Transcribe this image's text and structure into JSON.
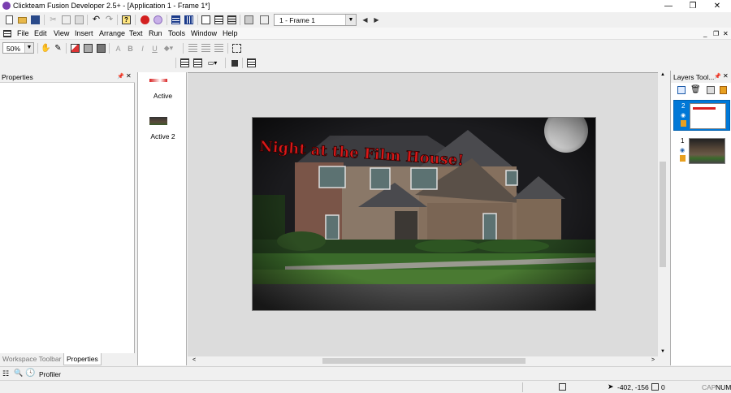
{
  "window": {
    "title": "Clickteam Fusion Developer 2.5+ - [Application 1 - Frame 1*]",
    "minimize_label": "—",
    "restore_label": "❐",
    "close_label": "✕"
  },
  "toolbar": {
    "frame_select_value": "1 - Frame 1",
    "zoom_value": "50%"
  },
  "menu": {
    "items": [
      "File",
      "Edit",
      "View",
      "Insert",
      "Arrange",
      "Text",
      "Run",
      "Tools",
      "Window",
      "Help"
    ]
  },
  "properties_panel": {
    "title": "Properties",
    "tabs": [
      "Workspace Toolbar",
      "Properties"
    ]
  },
  "object_list": {
    "items": [
      {
        "label": "Active"
      },
      {
        "label": "Active 2"
      }
    ]
  },
  "frame": {
    "banner_text": "Night at the Film House!"
  },
  "layers_panel": {
    "title": "Layers Tool...",
    "layers": [
      {
        "number": "2"
      },
      {
        "number": "1"
      }
    ]
  },
  "bottom_toolbar": {
    "profiler_label": "Profiler"
  },
  "status": {
    "coordinates": "-402, -156",
    "selection_count": "0",
    "caps_indicator": "CAP",
    "num_indicator": "NUM"
  },
  "colors": {
    "accent": "#0078d7",
    "banner_red": "#d81818",
    "editor_bg": "#dcdcdc"
  }
}
